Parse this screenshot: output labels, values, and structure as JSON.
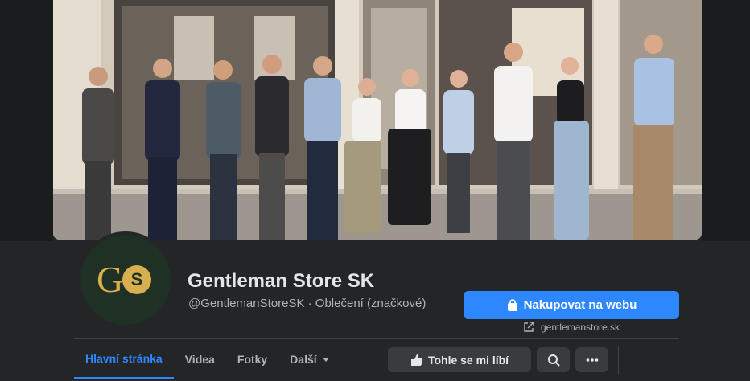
{
  "page": {
    "name": "Gentleman Store SK",
    "handle_category": "@GentlemanStoreSK · Oblečení (značkové)",
    "logo_letter_g": "G",
    "logo_letter_s": "S"
  },
  "cta": {
    "shop_label": "Nakupovat na webu",
    "shop_icon": "shopping-bag-icon",
    "website": "gentlemanstore.sk",
    "website_icon": "external-link-icon"
  },
  "tabs": [
    {
      "label": "Hlavní stránka",
      "active": true
    },
    {
      "label": "Videa",
      "active": false
    },
    {
      "label": "Fotky",
      "active": false
    },
    {
      "label": "Další",
      "active": false,
      "icon": "caret-down-icon"
    }
  ],
  "actions": {
    "like_label": "Tohle se mi líbí",
    "like_icon": "thumbs-up-icon",
    "search_icon": "search-icon",
    "more_icon": "more-icon"
  },
  "colors": {
    "background": "#242526",
    "accent": "#2d88ff",
    "button_secondary": "#3a3b3c",
    "logo_gold": "#d8ae4f",
    "logo_bg": "#1f3025"
  }
}
